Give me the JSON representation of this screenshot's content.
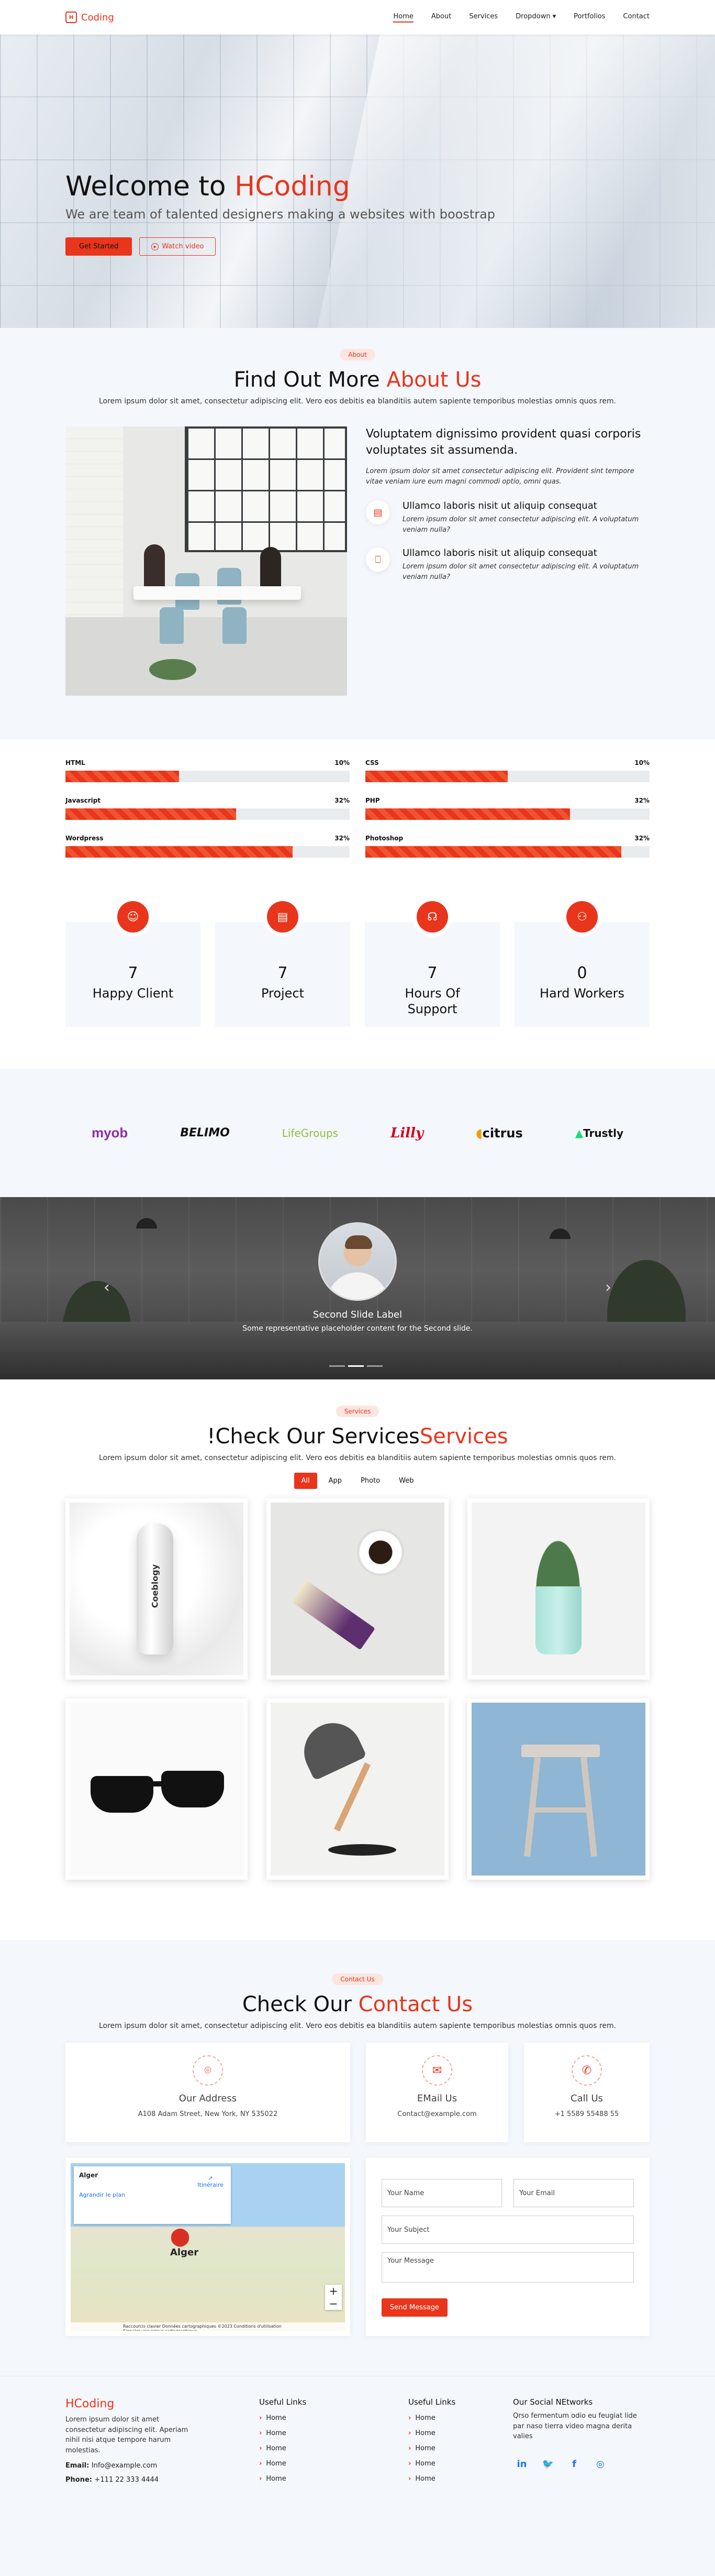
{
  "header": {
    "brand": "Coding",
    "nav": [
      "Home",
      "About",
      "Services",
      "Dropdown ▾",
      "Portfolios",
      "Contact"
    ]
  },
  "hero": {
    "title_start": "Welcome to ",
    "title_highlight": "HCoding",
    "subtitle": "We are team of talented designers making a websites with boostrap",
    "btn_primary": "Get Started",
    "btn_secondary": "Watch video"
  },
  "about": {
    "badge": "About",
    "title_start": "Find Out More ",
    "title_highlight": "About Us",
    "lead": "Lorem ipsum dolor sit amet, consectetur adipiscing elit. Vero eos debitis ea blanditiis autem sapiente temporibus molestias omnis quos rem.",
    "heading": "Voluptatem dignissimo provident quasi corporis voluptates sit assumenda.",
    "intro": "Lorem ipsum dolor sit amet consectetur adipiscing elit. Provident sint tempore vitae veniam iure eum magni commodi optio, omni quas.",
    "features": [
      {
        "title": "Ullamco laboris nisit ut aliquip consequat",
        "text": "Lorem ipsum dolor sit amet consectetur adipiscing elit. A voluptatum veniam nulla?"
      },
      {
        "title": "Ullamco laboris nisit ut aliquip consequat",
        "text": "Lorem ipsum dolor sit amet consectetur adipiscing elit. A voluptatum veniam nulla?"
      }
    ]
  },
  "skills": [
    {
      "name": "HTML",
      "label": "10%",
      "fill": 40
    },
    {
      "name": "CSS",
      "label": "10%",
      "fill": 50
    },
    {
      "name": "Javascript",
      "label": "32%",
      "fill": 60
    },
    {
      "name": "PHP",
      "label": "32%",
      "fill": 72
    },
    {
      "name": "Wordpress",
      "label": "32%",
      "fill": 80
    },
    {
      "name": "Photoshop",
      "label": "32%",
      "fill": 90
    }
  ],
  "stats": [
    {
      "num": "7",
      "label": "Happy Client",
      "icon": "smile-icon"
    },
    {
      "num": "7",
      "label": "Project",
      "icon": "document-icon"
    },
    {
      "num": "7",
      "label": "Hours Of Support",
      "icon": "headset-icon"
    },
    {
      "num": "0",
      "label": "Hard Workers",
      "icon": "people-icon"
    }
  ],
  "clients": [
    "myob",
    "BELIMO",
    "LifeGroups",
    "Lilly",
    "citrus",
    "Trustly"
  ],
  "slider": {
    "label": "Second Slide Label",
    "text": "Some representative placeholder content for the Second slide."
  },
  "portfolio": {
    "badge": "Services",
    "title_start": "!Check Our Services",
    "title_highlight": "Services",
    "lead": "Lorem ipsum dolor sit amet, consectetur adipiscing elit. Vero eos debitis ea blanditiis autem sapiente temporibus molestias omnis quos rem.",
    "filters": [
      "All",
      "App",
      "Photo",
      "Web"
    ],
    "bottle_text": "Coeblogy"
  },
  "contact": {
    "badge": "Contact Us",
    "title_start": "Check Our ",
    "title_highlight": "Contact Us",
    "lead": "Lorem ipsum dolor sit amet, consectetur adipiscing elit. Vero eos debitis ea blanditiis autem sapiente temporibus molestias omnis quos rem.",
    "cards": [
      {
        "title": "Our Address",
        "value": "A108 Adam Street, New York, NY 535022"
      },
      {
        "title": "EMail Us",
        "value": "Contact@example.com"
      },
      {
        "title": "Call Us",
        "value": "+1 5589 55488 55"
      }
    ],
    "map": {
      "place": "Alger",
      "link_enlarge": "Agrandir le plan",
      "link_directions": "Itinéraire",
      "city": "Alger",
      "footer": "Raccourcis clavier  Données cartographiques ©2023  Conditions d'utilisation  Signaler une erreur cartographique"
    },
    "form": {
      "name": "Your Name",
      "email": "Your Email",
      "subject": "Your Subject",
      "message": "Your Message",
      "send": "Send Message"
    }
  },
  "footer": {
    "brand": "HCoding",
    "about": "Lorem ipsum dolor sit amet consectetur adipiscing elit. Aperiam nihil nisi atque tempore harum molestias.",
    "email_label": "Email: ",
    "email": "Info@example.com",
    "phone_label": "Phone: ",
    "phone": "+111 22 333 4444",
    "col2_title": "Useful Links",
    "col2": [
      "Home",
      "Home",
      "Home",
      "Home",
      "Home"
    ],
    "col3_title": "Useful Links",
    "col3": [
      "Home",
      "Home",
      "Home",
      "Home",
      "Home"
    ],
    "col4_title": "Our Social NEtworks",
    "col4_text": "Qrso fermentum odio eu feugiat lide par naso tierra video magna derita valies"
  },
  "colors": {
    "accent": "#e8351c",
    "light_bg": "#f4f7fc"
  }
}
